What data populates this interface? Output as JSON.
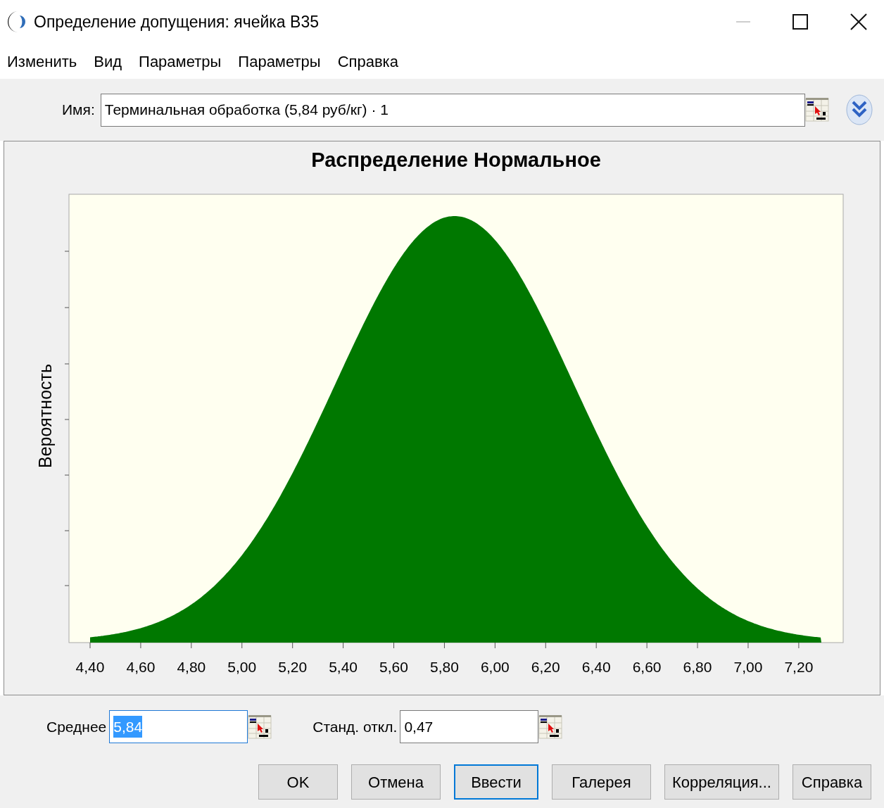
{
  "window": {
    "title": "Определение допущения: ячейка B35"
  },
  "menu": [
    "Изменить",
    "Вид",
    "Параметры",
    "Параметры",
    "Справка"
  ],
  "name_field": {
    "label": "Имя:",
    "value": "Терминальная обработка (5,84 руб/кг) · 1"
  },
  "chart": {
    "title": "Распределение Нормальное",
    "ylabel": "Вероятность",
    "xtick_labels": [
      "4,40",
      "4,60",
      "4,80",
      "5,00",
      "5,20",
      "5,40",
      "5,60",
      "5,80",
      "6,00",
      "6,20",
      "6,40",
      "6,60",
      "6,80",
      "7,00",
      "7,20"
    ]
  },
  "parameters": [
    {
      "label": "Среднее",
      "value": "5,84",
      "text_selected": true
    },
    {
      "label": "Станд. откл.",
      "value": "0,47",
      "text_selected": false
    }
  ],
  "buttons": [
    {
      "label": "OK",
      "default": false
    },
    {
      "label": "Отмена",
      "default": false
    },
    {
      "label": "Ввести",
      "default": true
    },
    {
      "label": "Галерея",
      "default": false
    },
    {
      "label": "Корреляция...",
      "default": false
    },
    {
      "label": "Справка",
      "default": false
    }
  ]
}
